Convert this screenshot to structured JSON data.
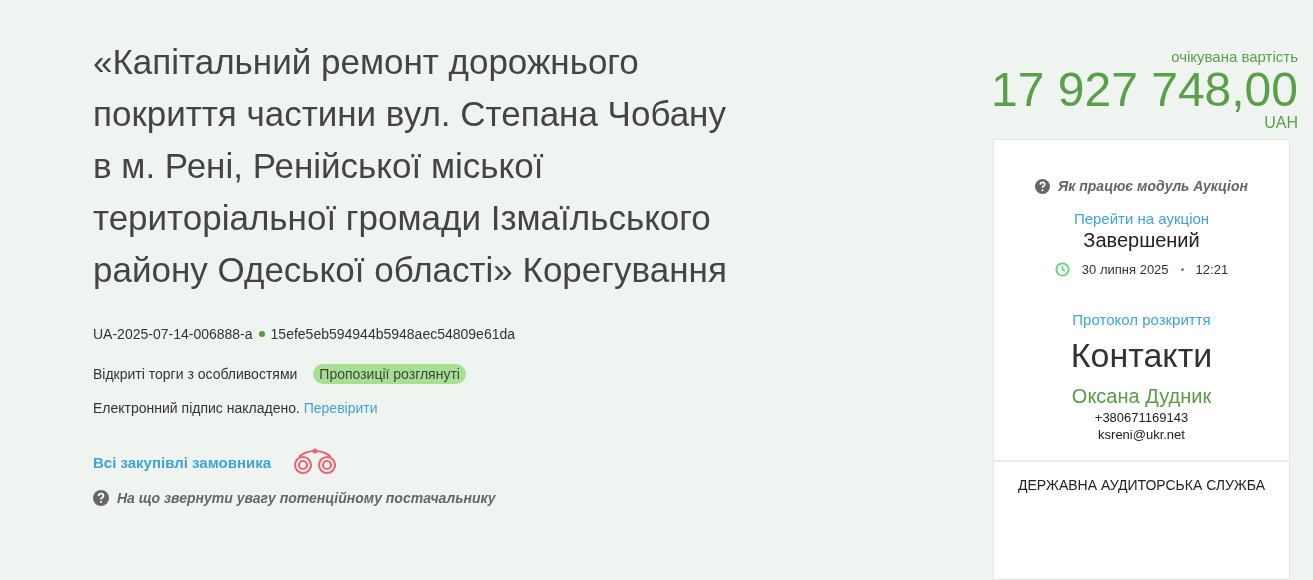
{
  "title": "«Капітальний ремонт дорожнього покриття частини вул. Степана Чобану в м. Рені, Ренійської міської територіальної громади Ізмаїльського району Одеської області» Корегування",
  "ids": {
    "tender_id": "UA-2025-07-14-006888-a",
    "hash": "15efe5eb594944b5948aec54809e61da"
  },
  "procedure": {
    "type": "Відкриті торги з особливостями",
    "status": "Пропозиції розглянуті"
  },
  "signature": {
    "text": "Електронний підпис накладено.",
    "link": "Перевірити"
  },
  "customer_link": "Всі закупівлі замовника",
  "hint": "На що звернути увагу потенційному постачальнику",
  "price": {
    "label": "очікувана вартість",
    "amount": "17 927 748,00",
    "currency": "UAH"
  },
  "auction": {
    "help": "Як працює модуль Аукціон",
    "link": "Перейти на аукціон",
    "status": "Завершений",
    "date": "30 липня 2025",
    "time": "12:21"
  },
  "protocol_link": "Протокол розкриття",
  "contacts": {
    "heading": "Контакти",
    "name": "Оксана Дудник",
    "phone": "+380671169143",
    "email": "ksreni@ukr.net"
  },
  "organization": "ДЕРЖАВНА АУДИТОРСЬКА СЛУЖБА"
}
